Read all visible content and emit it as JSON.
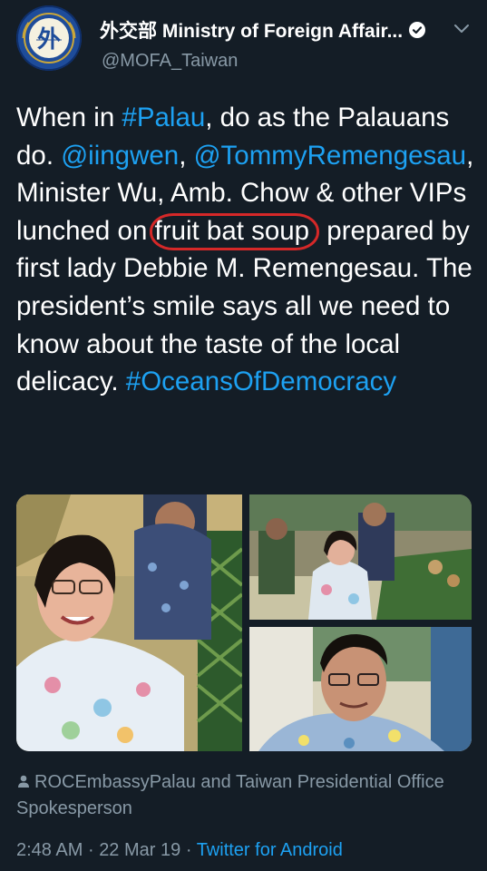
{
  "account": {
    "display_name": "外交部 Ministry of Foreign Affair...",
    "handle": "@MOFA_Taiwan",
    "avatar_glyph": "外",
    "verified": true
  },
  "tweet": {
    "segments": [
      {
        "text": "When in ",
        "kind": "plain"
      },
      {
        "text": "#Palau",
        "kind": "link"
      },
      {
        "text": ", do as the Palauans do. ",
        "kind": "plain"
      },
      {
        "text": "@iingwen",
        "kind": "link"
      },
      {
        "text": ", ",
        "kind": "plain"
      },
      {
        "text": "@TommyRemengesau",
        "kind": "link"
      },
      {
        "text": ", Minister Wu, Amb. Chow & other VIPs lunched on ",
        "kind": "plain"
      },
      {
        "text": "fruit bat soup",
        "kind": "circled"
      },
      {
        "text": " prepared by first lady Debbie M. Remengesau. The president’s smile says all we need to know about the taste of the local delicacy. ",
        "kind": "plain"
      },
      {
        "text": "#OceansOfDemocracy",
        "kind": "link"
      }
    ]
  },
  "media": {
    "photo_count": 3
  },
  "attribution": {
    "text": "ROCEmbassyPalau and Taiwan Presidential Office Spokesperson"
  },
  "meta": {
    "time": "2:48 AM",
    "separator": "·",
    "date": "22 Mar 19",
    "source": "Twitter for Android"
  },
  "colors": {
    "background": "#141d26",
    "link": "#1da1f2",
    "secondary_text": "#8899a6",
    "highlight_circle": "#d52828"
  }
}
